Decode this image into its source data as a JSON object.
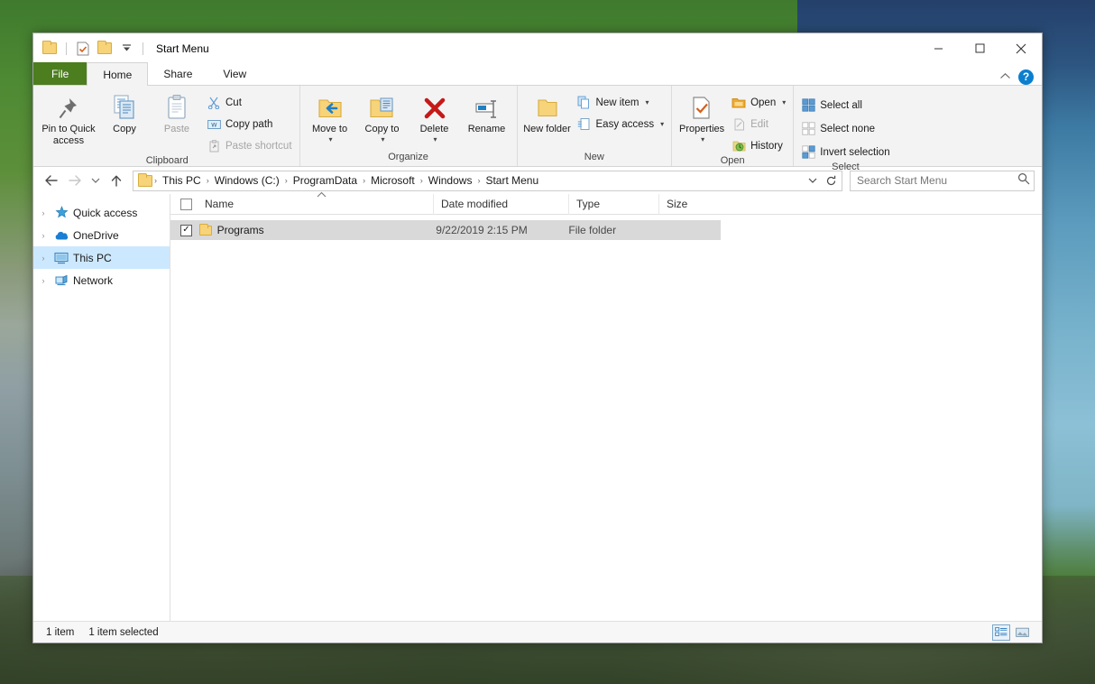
{
  "window": {
    "title": "Start Menu",
    "quick_access": [
      {
        "name": "folder-icon",
        "glyph": "folder"
      },
      {
        "name": "properties-icon",
        "glyph": "props"
      },
      {
        "name": "new-folder-icon",
        "glyph": "folder"
      },
      {
        "name": "customize-qat-icon",
        "glyph": "▾"
      }
    ],
    "caption": {
      "minimize": "—",
      "maximize": "▢",
      "close": "✕"
    }
  },
  "tabs": [
    {
      "label": "File",
      "kind": "file"
    },
    {
      "label": "Home",
      "kind": "active"
    },
    {
      "label": "Share",
      "kind": "normal"
    },
    {
      "label": "View",
      "kind": "normal"
    }
  ],
  "tab_right": {
    "collapse_label": "⌃",
    "help_label": "?"
  },
  "ribbon": {
    "groups": [
      {
        "label": "Clipboard",
        "big": [
          {
            "label": "Pin to Quick access",
            "icon": "pin-icon",
            "disabled": false
          },
          {
            "label": "Copy",
            "icon": "copy-icon",
            "disabled": false
          },
          {
            "label": "Paste",
            "icon": "paste-icon",
            "disabled": true
          }
        ],
        "small": [
          {
            "label": "Cut",
            "icon": "cut-icon",
            "disabled": false
          },
          {
            "label": "Copy path",
            "icon": "copy-path-icon",
            "disabled": false
          },
          {
            "label": "Paste shortcut",
            "icon": "paste-shortcut-icon",
            "disabled": true
          }
        ]
      },
      {
        "label": "Organize",
        "big": [
          {
            "label": "Move to",
            "icon": "move-to-icon",
            "dropdown": true
          },
          {
            "label": "Copy to",
            "icon": "copy-to-icon",
            "dropdown": true
          },
          {
            "label": "Delete",
            "icon": "delete-icon",
            "dropdown": true
          },
          {
            "label": "Rename",
            "icon": "rename-icon",
            "dropdown": false
          }
        ],
        "small": []
      },
      {
        "label": "New",
        "big": [
          {
            "label": "New folder",
            "icon": "new-folder-icon",
            "disabled": false
          }
        ],
        "small": [
          {
            "label": "New item",
            "icon": "new-item-icon",
            "dropdown": true
          },
          {
            "label": "Easy access",
            "icon": "easy-access-icon",
            "dropdown": true
          }
        ]
      },
      {
        "label": "Open",
        "big": [
          {
            "label": "Properties",
            "icon": "properties-icon",
            "dropdown": true
          }
        ],
        "small": [
          {
            "label": "Open",
            "icon": "open-icon",
            "dropdown": true,
            "disabled": false
          },
          {
            "label": "Edit",
            "icon": "edit-icon",
            "disabled": true
          },
          {
            "label": "History",
            "icon": "history-icon",
            "disabled": false
          }
        ]
      },
      {
        "label": "Select",
        "big": [],
        "small": [
          {
            "label": "Select all",
            "icon": "select-all-icon",
            "disabled": false
          },
          {
            "label": "Select none",
            "icon": "select-none-icon",
            "disabled": false
          },
          {
            "label": "Invert selection",
            "icon": "invert-selection-icon",
            "disabled": false
          }
        ]
      }
    ]
  },
  "addressbar": {
    "back_label": "←",
    "forward_label": "→",
    "recent_label": "⌄",
    "up_label": "↑",
    "breadcrumbs": [
      "This PC",
      "Windows (C:)",
      "ProgramData",
      "Microsoft",
      "Windows",
      "Start Menu"
    ],
    "separator": "›",
    "dropdown_label": "⌄",
    "refresh_label": "↻"
  },
  "search": {
    "placeholder": "Search Start Menu",
    "value": "",
    "icon": "search-icon"
  },
  "navpane": {
    "items": [
      {
        "label": "Quick access",
        "icon": "star-pin-icon",
        "selected": false
      },
      {
        "label": "OneDrive",
        "icon": "cloud-icon",
        "selected": false
      },
      {
        "label": "This PC",
        "icon": "monitor-icon",
        "selected": true
      },
      {
        "label": "Network",
        "icon": "network-icon",
        "selected": false
      }
    ],
    "chevron": "›"
  },
  "filelist": {
    "columns": [
      {
        "label": "Name",
        "key": "name"
      },
      {
        "label": "Date modified",
        "key": "date"
      },
      {
        "label": "Type",
        "key": "type"
      },
      {
        "label": "Size",
        "key": "size"
      }
    ],
    "sort_indicator": "⌃",
    "rows": [
      {
        "name": "Programs",
        "date": "9/22/2019 2:15 PM",
        "type": "File folder",
        "size": "",
        "selected": true,
        "checked": true,
        "icon": "folder-icon",
        "check_glyph": "✓"
      }
    ]
  },
  "statusbar": {
    "item_count": "1 item",
    "selection": "1 item selected",
    "views": [
      {
        "name": "details-view-button",
        "active": true
      },
      {
        "name": "large-icons-view-button",
        "active": false
      }
    ]
  },
  "colors": {
    "file_tab_green": "#4c7d1f",
    "selection_blue": "#cce8ff",
    "row_selected_grey": "#d9d9d9",
    "help_blue": "#0b7fcf"
  }
}
